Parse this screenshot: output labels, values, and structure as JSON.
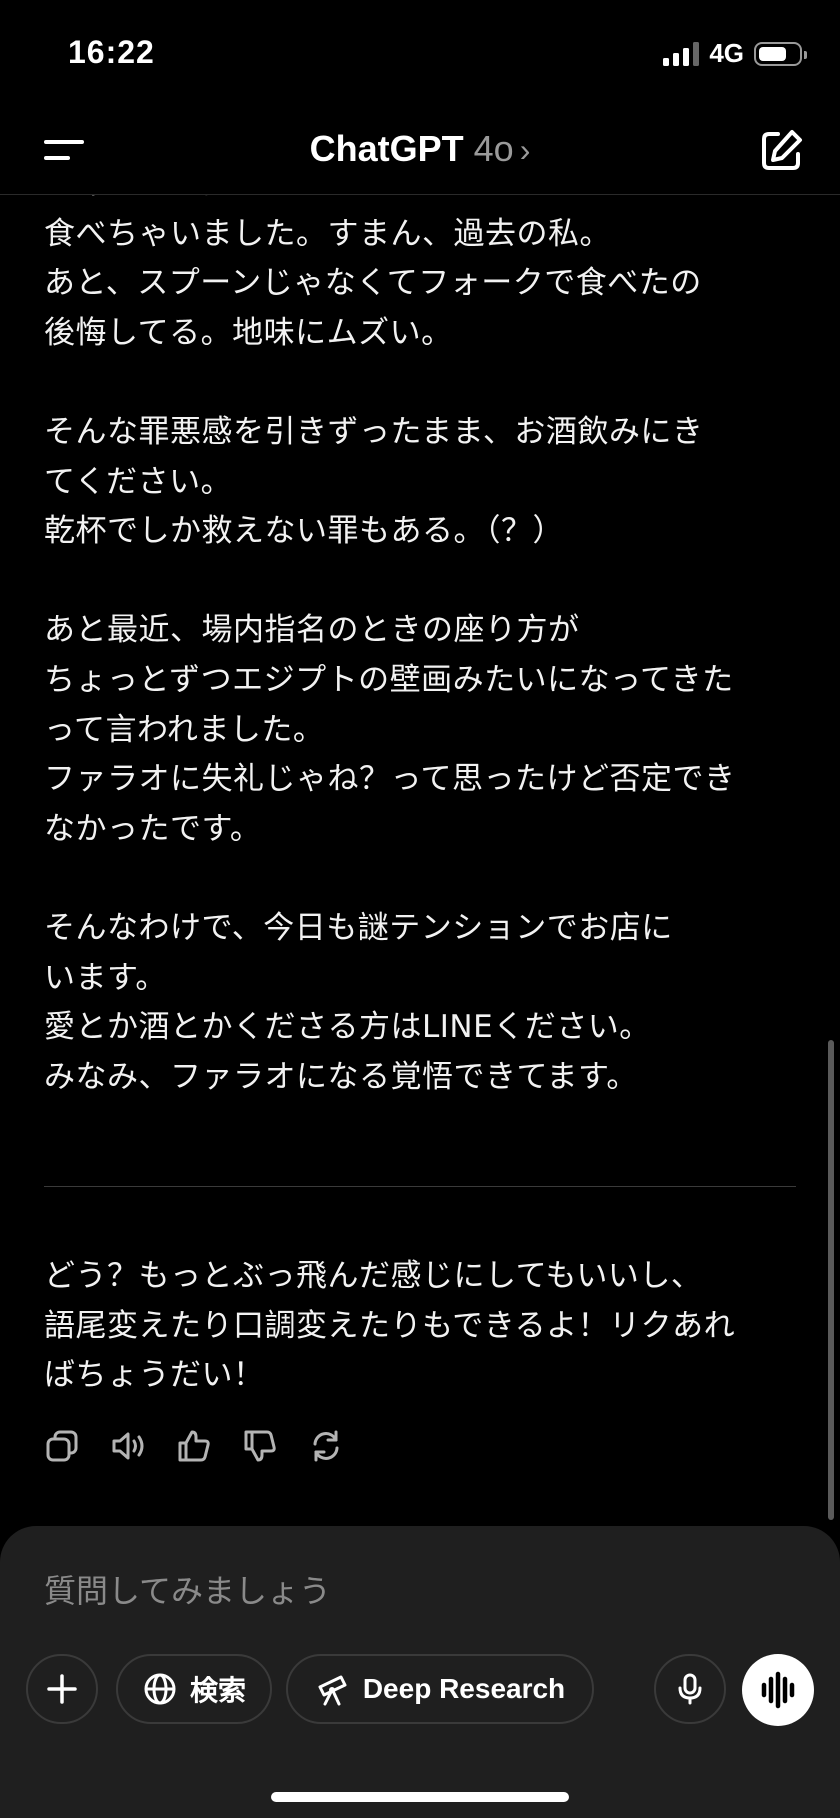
{
  "status_bar": {
    "time": "16:22",
    "network": "4G"
  },
  "header": {
    "model_name": "ChatGPT",
    "model_version": "4o",
    "chevron": "›"
  },
  "chat": {
    "message_lines": [
      "てあったのに",
      "食べちゃいました。すまん、過去の私。",
      "あと、スプーンじゃなくてフォークで食べたの",
      "後悔してる。地味にムズい。",
      "",
      "そんな罪悪感を引きずったまま、お酒飲みにき",
      "てください。",
      "乾杯でしか救えない罪もある。（？）",
      "",
      "あと最近、場内指名のときの座り方が",
      "ちょっとずつエジプトの壁画みたいになってきた",
      "って言われました。",
      "ファラオに失礼じゃね？って思ったけど否定でき",
      "なかったです。",
      "",
      "そんなわけで、今日も謎テンションでお店に",
      "います。",
      "愛とか酒とかくださる方はLINEください。",
      "みなみ、ファラオになる覚悟できてます。"
    ],
    "reply_lines": [
      "どう？もっとぶっ飛んだ感じにしてもいいし、",
      "語尾変えたり口調変えたりもできるよ！リクあれ",
      "ばちょうだい！"
    ]
  },
  "composer": {
    "placeholder": "質問してみましょう",
    "search_label": "検索",
    "deep_research_label": "Deep Research"
  },
  "icons": {
    "menu": "menu-icon",
    "new_chat": "edit-icon",
    "copy": "copy-icon",
    "read_aloud": "speaker-icon",
    "good": "thumbs-up-icon",
    "bad": "thumbs-down-icon",
    "regenerate": "refresh-icon",
    "plus": "plus-icon",
    "globe": "globe-icon",
    "telescope": "telescope-icon",
    "mic": "mic-icon",
    "voice": "voice-wave-icon"
  }
}
